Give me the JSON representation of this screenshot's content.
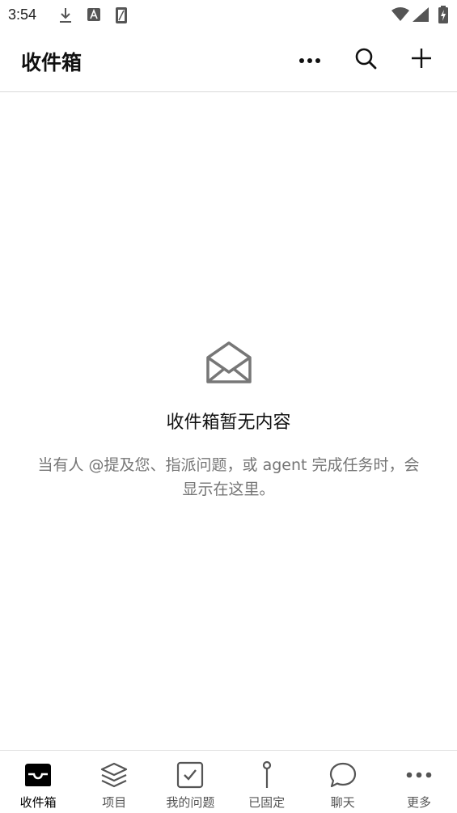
{
  "status_bar": {
    "time": "3:54",
    "icons": [
      "download-icon",
      "font-a-icon",
      "sim-card-icon",
      "wifi-icon",
      "signal-icon",
      "battery-charging-icon"
    ]
  },
  "header": {
    "title": "收件箱",
    "actions": [
      "more-horizontal-icon",
      "search-icon",
      "plus-icon"
    ]
  },
  "empty_state": {
    "icon": "open-envelope-icon",
    "title": "收件箱暂无内容",
    "description": "当有人 @提及您、指派问题，或 agent 完成任务时，会显示在这里。"
  },
  "bottom_nav": {
    "active": "inbox",
    "items": [
      {
        "label": "收件箱",
        "icon": "inbox-tray-icon"
      },
      {
        "label": "项目",
        "icon": "layers-icon"
      },
      {
        "label": "我的问题",
        "icon": "checkbox-icon"
      },
      {
        "label": "已固定",
        "icon": "pin-icon"
      },
      {
        "label": "聊天",
        "icon": "chat-bubble-icon"
      },
      {
        "label": "更多",
        "icon": "more-horizontal-icon"
      }
    ]
  },
  "colors": {
    "background": "#ffffff",
    "text_primary": "#111111",
    "text_secondary": "#757575",
    "divider": "#d9d9d9",
    "icon_muted": "#777777"
  }
}
